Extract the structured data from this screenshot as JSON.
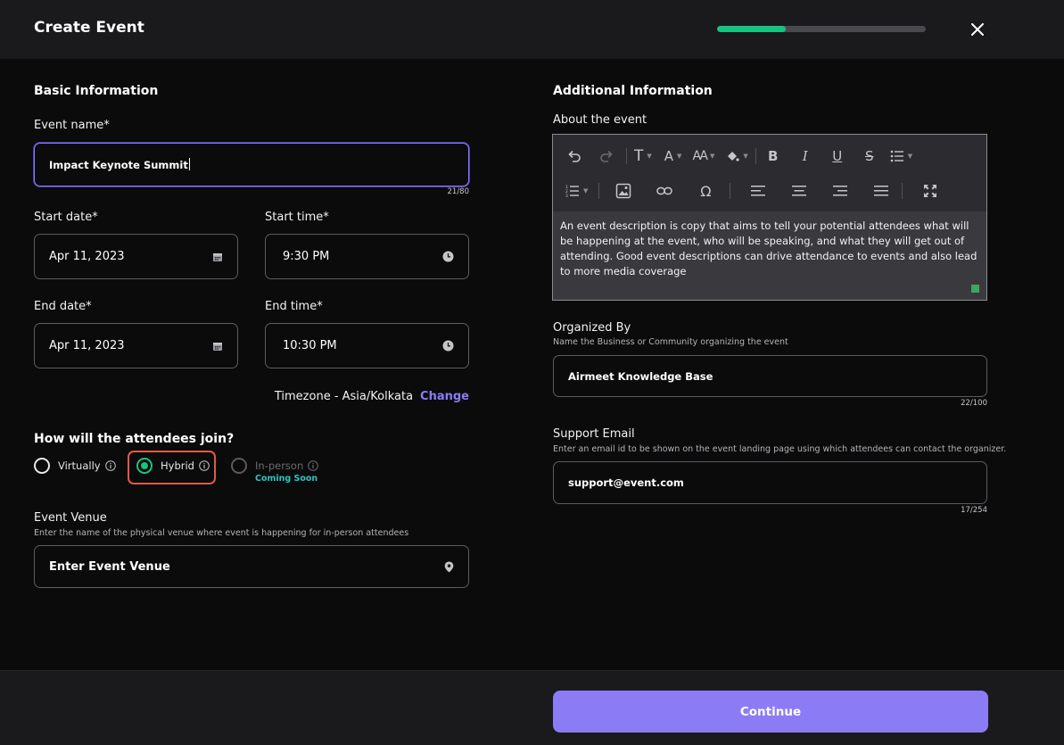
{
  "header": {
    "title": "Create Event",
    "progress_percent": 33
  },
  "basic": {
    "section_title": "Basic Information",
    "event_name": {
      "label": "Event name*",
      "value": "Impact Keynote Summit",
      "counter": "21/80"
    },
    "start_date": {
      "label": "Start date*",
      "value": "Apr 11, 2023"
    },
    "start_time": {
      "label": "Start time*",
      "value": "9:30 PM"
    },
    "end_date": {
      "label": "End date*",
      "value": "Apr 11, 2023"
    },
    "end_time": {
      "label": "End time*",
      "value": "10:30 PM"
    },
    "timezone": {
      "text": "Timezone - Asia/Kolkata",
      "change_label": "Change"
    }
  },
  "join": {
    "question": "How will the attendees join?",
    "options": [
      {
        "label": "Virtually",
        "selected": false,
        "disabled": false
      },
      {
        "label": "Hybrid",
        "selected": true,
        "disabled": false
      },
      {
        "label": "In-person",
        "selected": false,
        "disabled": true,
        "badge": "Coming Soon"
      }
    ]
  },
  "venue": {
    "label": "Event Venue",
    "help": "Enter the name of the physical venue where event is happening for in-person attendees",
    "placeholder": "Enter Event Venue"
  },
  "additional": {
    "section_title": "Additional Information",
    "about": {
      "label": "About the event",
      "text": "An event description is copy that aims to tell your potential attendees what will be happening at the event, who will be speaking, and what they will get out of attending. Good event descriptions can drive attendance to events and also lead to more media coverage"
    },
    "organized_by": {
      "label": "Organized By",
      "help": "Name the Business or Community organizing the event",
      "value": "Airmeet Knowledge Base",
      "counter": "22/100"
    },
    "support_email": {
      "label": "Support Email",
      "help": "Enter an email id to be shown on the event landing page using which attendees can contact the organizer.",
      "value": "support@event.com",
      "counter": "17/254"
    }
  },
  "editor_toolbar": {
    "row1": [
      "undo",
      "redo",
      "text-style",
      "font-color",
      "font-size",
      "fill-color",
      "bold",
      "italic",
      "underline",
      "strikethrough",
      "bulleted-list"
    ],
    "row2": [
      "numbered-list",
      "image",
      "link",
      "special-character",
      "align-left",
      "align-center",
      "align-right",
      "justify",
      "fullscreen"
    ]
  },
  "footer": {
    "continue_label": "Continue"
  },
  "colors": {
    "accent": "#8b7cf6",
    "success": "#16c47f",
    "highlight": "#e15a44",
    "badge": "#2ec4c4"
  }
}
